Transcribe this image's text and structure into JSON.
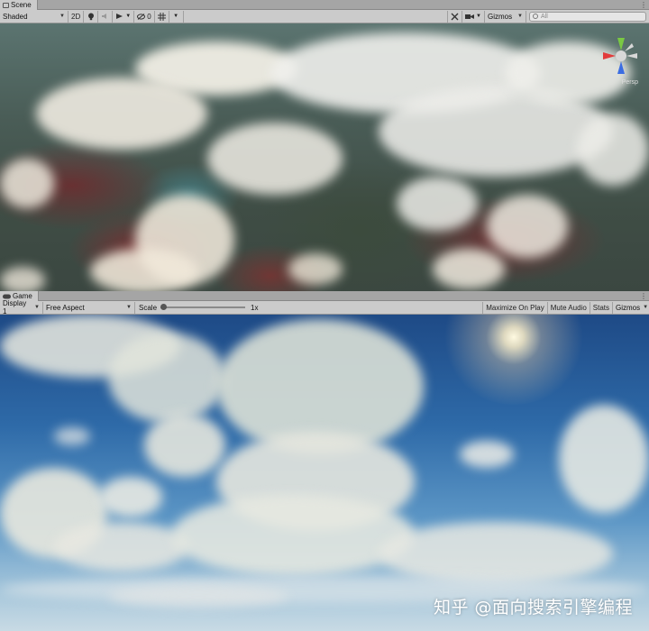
{
  "scene_panel": {
    "tab_label": "Scene",
    "tab_icon": "grid-icon",
    "toolbar": {
      "draw_mode": "Shaded",
      "mode_2d": "2D",
      "lighting_icon": "lightbulb-icon",
      "audio_icon": "speaker-icon",
      "effects_icon": "effects-icon",
      "hidden_count": "0",
      "grid_icon": "grid-icon",
      "tools_icon": "tools-icon",
      "camera_icon": "camera-icon",
      "gizmos_label": "Gizmos",
      "search_placeholder": "All"
    },
    "gizmo_label": "Persp"
  },
  "game_panel": {
    "tab_label": "Game",
    "tab_icon": "gamepad-icon",
    "toolbar": {
      "display": "Display 1",
      "aspect": "Free Aspect",
      "scale_label": "Scale",
      "scale_value": "1x",
      "scale_fraction": 0.0,
      "maximize_on_play": "Maximize On Play",
      "mute_audio": "Mute Audio",
      "stats": "Stats",
      "gizmos": "Gizmos"
    }
  },
  "watermark": "知乎 @面向搜索引擎编程"
}
